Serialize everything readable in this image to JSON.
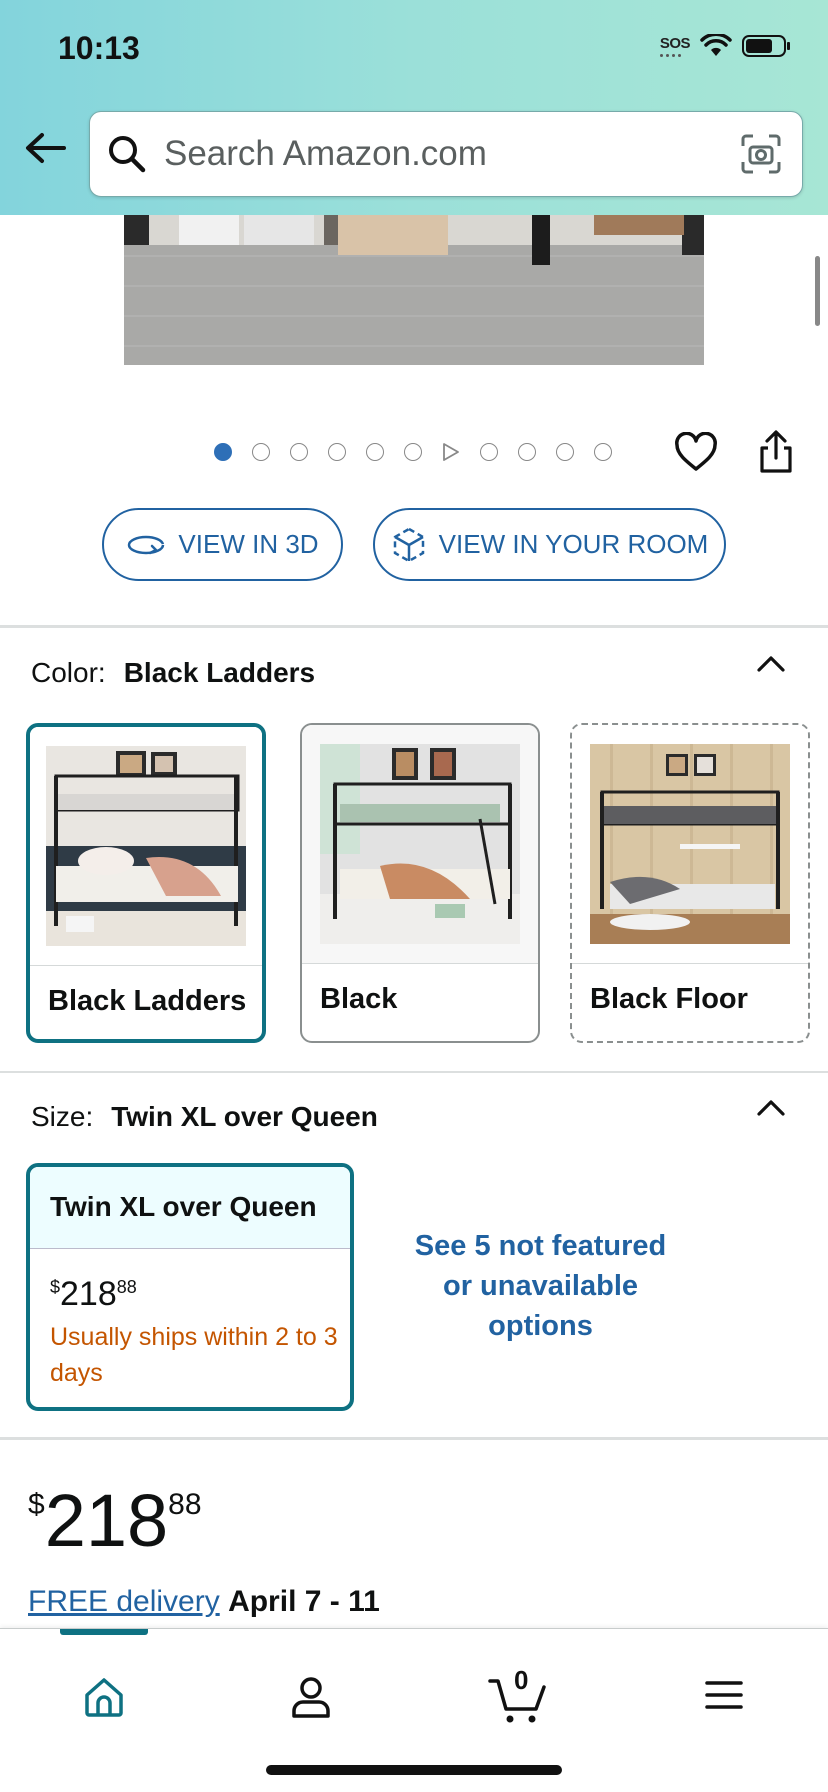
{
  "status_bar": {
    "time": "10:13",
    "sos": "SOS"
  },
  "search": {
    "placeholder": "Search Amazon.com"
  },
  "gallery": {
    "image_count": 11,
    "active_index": 0,
    "video_index": 6
  },
  "actions": {
    "view_3d_label": "VIEW IN 3D",
    "view_room_label": "VIEW IN YOUR ROOM"
  },
  "color": {
    "label": "Color:",
    "selected": "Black Ladders",
    "options": [
      {
        "name": "Black Ladders",
        "state": "selected"
      },
      {
        "name": "Black",
        "state": "available"
      },
      {
        "name": "Black Floor",
        "state": "unavailable"
      }
    ]
  },
  "size": {
    "label": "Size:",
    "selected": "Twin XL over Queen",
    "card": {
      "name": "Twin XL over Queen",
      "price_currency": "$",
      "price_whole": "218",
      "price_cents": "88",
      "shipping": "Usually ships within 2 to 3 days"
    },
    "not_featured": "See 5 not featured or unavailable options"
  },
  "price": {
    "currency": "$",
    "whole": "218",
    "cents": "88"
  },
  "delivery": {
    "link": "FREE delivery",
    "dates": "April 7 - 11"
  },
  "nav": {
    "cart_count": "0",
    "active": "home"
  },
  "colors": {
    "accent_teal": "#0e7182",
    "link_blue": "#2162a1",
    "shipping_orange": "#c45500"
  }
}
